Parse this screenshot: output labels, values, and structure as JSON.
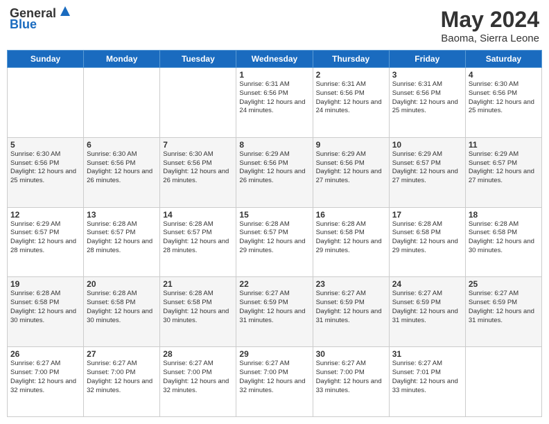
{
  "logo": {
    "general": "General",
    "blue": "Blue"
  },
  "header": {
    "month_year": "May 2024",
    "location": "Baoma, Sierra Leone"
  },
  "weekdays": [
    "Sunday",
    "Monday",
    "Tuesday",
    "Wednesday",
    "Thursday",
    "Friday",
    "Saturday"
  ],
  "weeks": [
    [
      {
        "day": "",
        "info": ""
      },
      {
        "day": "",
        "info": ""
      },
      {
        "day": "",
        "info": ""
      },
      {
        "day": "1",
        "info": "Sunrise: 6:31 AM\nSunset: 6:56 PM\nDaylight: 12 hours and 24 minutes."
      },
      {
        "day": "2",
        "info": "Sunrise: 6:31 AM\nSunset: 6:56 PM\nDaylight: 12 hours and 24 minutes."
      },
      {
        "day": "3",
        "info": "Sunrise: 6:31 AM\nSunset: 6:56 PM\nDaylight: 12 hours and 25 minutes."
      },
      {
        "day": "4",
        "info": "Sunrise: 6:30 AM\nSunset: 6:56 PM\nDaylight: 12 hours and 25 minutes."
      }
    ],
    [
      {
        "day": "5",
        "info": "Sunrise: 6:30 AM\nSunset: 6:56 PM\nDaylight: 12 hours and 25 minutes."
      },
      {
        "day": "6",
        "info": "Sunrise: 6:30 AM\nSunset: 6:56 PM\nDaylight: 12 hours and 26 minutes."
      },
      {
        "day": "7",
        "info": "Sunrise: 6:30 AM\nSunset: 6:56 PM\nDaylight: 12 hours and 26 minutes."
      },
      {
        "day": "8",
        "info": "Sunrise: 6:29 AM\nSunset: 6:56 PM\nDaylight: 12 hours and 26 minutes."
      },
      {
        "day": "9",
        "info": "Sunrise: 6:29 AM\nSunset: 6:56 PM\nDaylight: 12 hours and 27 minutes."
      },
      {
        "day": "10",
        "info": "Sunrise: 6:29 AM\nSunset: 6:57 PM\nDaylight: 12 hours and 27 minutes."
      },
      {
        "day": "11",
        "info": "Sunrise: 6:29 AM\nSunset: 6:57 PM\nDaylight: 12 hours and 27 minutes."
      }
    ],
    [
      {
        "day": "12",
        "info": "Sunrise: 6:29 AM\nSunset: 6:57 PM\nDaylight: 12 hours and 28 minutes."
      },
      {
        "day": "13",
        "info": "Sunrise: 6:28 AM\nSunset: 6:57 PM\nDaylight: 12 hours and 28 minutes."
      },
      {
        "day": "14",
        "info": "Sunrise: 6:28 AM\nSunset: 6:57 PM\nDaylight: 12 hours and 28 minutes."
      },
      {
        "day": "15",
        "info": "Sunrise: 6:28 AM\nSunset: 6:57 PM\nDaylight: 12 hours and 29 minutes."
      },
      {
        "day": "16",
        "info": "Sunrise: 6:28 AM\nSunset: 6:58 PM\nDaylight: 12 hours and 29 minutes."
      },
      {
        "day": "17",
        "info": "Sunrise: 6:28 AM\nSunset: 6:58 PM\nDaylight: 12 hours and 29 minutes."
      },
      {
        "day": "18",
        "info": "Sunrise: 6:28 AM\nSunset: 6:58 PM\nDaylight: 12 hours and 30 minutes."
      }
    ],
    [
      {
        "day": "19",
        "info": "Sunrise: 6:28 AM\nSunset: 6:58 PM\nDaylight: 12 hours and 30 minutes."
      },
      {
        "day": "20",
        "info": "Sunrise: 6:28 AM\nSunset: 6:58 PM\nDaylight: 12 hours and 30 minutes."
      },
      {
        "day": "21",
        "info": "Sunrise: 6:28 AM\nSunset: 6:58 PM\nDaylight: 12 hours and 30 minutes."
      },
      {
        "day": "22",
        "info": "Sunrise: 6:27 AM\nSunset: 6:59 PM\nDaylight: 12 hours and 31 minutes."
      },
      {
        "day": "23",
        "info": "Sunrise: 6:27 AM\nSunset: 6:59 PM\nDaylight: 12 hours and 31 minutes."
      },
      {
        "day": "24",
        "info": "Sunrise: 6:27 AM\nSunset: 6:59 PM\nDaylight: 12 hours and 31 minutes."
      },
      {
        "day": "25",
        "info": "Sunrise: 6:27 AM\nSunset: 6:59 PM\nDaylight: 12 hours and 31 minutes."
      }
    ],
    [
      {
        "day": "26",
        "info": "Sunrise: 6:27 AM\nSunset: 7:00 PM\nDaylight: 12 hours and 32 minutes."
      },
      {
        "day": "27",
        "info": "Sunrise: 6:27 AM\nSunset: 7:00 PM\nDaylight: 12 hours and 32 minutes."
      },
      {
        "day": "28",
        "info": "Sunrise: 6:27 AM\nSunset: 7:00 PM\nDaylight: 12 hours and 32 minutes."
      },
      {
        "day": "29",
        "info": "Sunrise: 6:27 AM\nSunset: 7:00 PM\nDaylight: 12 hours and 32 minutes."
      },
      {
        "day": "30",
        "info": "Sunrise: 6:27 AM\nSunset: 7:00 PM\nDaylight: 12 hours and 33 minutes."
      },
      {
        "day": "31",
        "info": "Sunrise: 6:27 AM\nSunset: 7:01 PM\nDaylight: 12 hours and 33 minutes."
      },
      {
        "day": "",
        "info": ""
      }
    ]
  ]
}
